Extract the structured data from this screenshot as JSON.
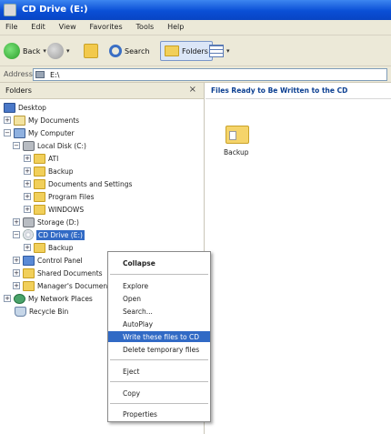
{
  "window": {
    "title": "CD Drive (E:)"
  },
  "menu": [
    "File",
    "Edit",
    "View",
    "Favorites",
    "Tools",
    "Help"
  ],
  "toolbar": {
    "back_label": "Back",
    "search_label": "Search",
    "folders_label": "Folders"
  },
  "address": {
    "label": "Address",
    "value": "E:\\"
  },
  "folders_pane": {
    "title": "Folders",
    "close_glyph": "×",
    "tree": [
      {
        "label": "Desktop"
      },
      {
        "label": "My Documents"
      },
      {
        "label": "My Computer"
      },
      {
        "label": "Local Disk (C:)"
      },
      {
        "label": "ATI"
      },
      {
        "label": "Backup"
      },
      {
        "label": "Documents and Settings"
      },
      {
        "label": "Program Files"
      },
      {
        "label": "WINDOWS"
      },
      {
        "label": "Storage (D:)"
      },
      {
        "label": "CD Drive (E:)"
      },
      {
        "label": "Backup"
      },
      {
        "label": "Control Panel"
      },
      {
        "label": "Shared Documents"
      },
      {
        "label": "Manager's Documents"
      },
      {
        "label": "My Network Places"
      },
      {
        "label": "Recycle Bin"
      }
    ]
  },
  "content": {
    "header": "Files Ready to Be Written to the CD",
    "items": [
      {
        "label": "Backup"
      }
    ]
  },
  "context_menu": {
    "items": [
      "Collapse",
      "Explore",
      "Open",
      "Search...",
      "AutoPlay",
      "Write these files to CD",
      "Delete temporary files",
      "Eject",
      "Copy",
      "Properties"
    ]
  },
  "colors": {
    "title_bar": "#0a4fd6",
    "selection": "#316ac5",
    "chrome": "#ece9d8"
  }
}
